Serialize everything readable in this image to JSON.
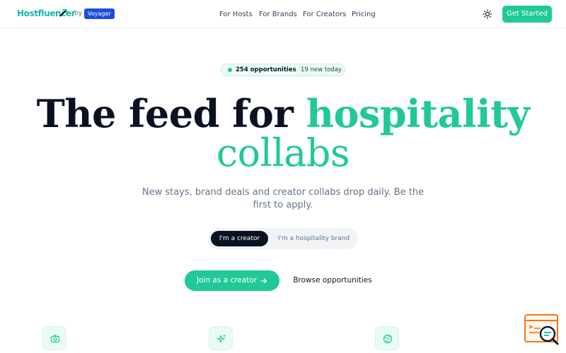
{
  "header": {
    "logo_text": "Hostfluencer",
    "by_label": "by",
    "partner_badge": "Voyager",
    "nav": [
      {
        "label": "For Hosts"
      },
      {
        "label": "For Brands"
      },
      {
        "label": "For Creators"
      },
      {
        "label": "Pricing"
      }
    ],
    "theme_toggle_icon": "sun-icon",
    "cta_label": "Get Started"
  },
  "stats_pill": {
    "count_label": "254 opportunities",
    "separator": "·",
    "new_label": "19 new today"
  },
  "hero": {
    "title_dark": "The feed for",
    "title_accent_1": "hospitality",
    "title_accent_2": "collabs",
    "subtitle": "New stays, brand deals and creator collabs drop daily. Be the first to apply."
  },
  "audience_toggle": {
    "options": [
      {
        "label": "I'm a creator",
        "selected": true
      },
      {
        "label": "I'm a hospitality brand",
        "selected": false
      }
    ]
  },
  "actions": {
    "primary_label": "Join as a creator",
    "primary_icon": "arrow-right-icon",
    "secondary_label": "Browse opportunities"
  },
  "features": {
    "icons": [
      "camera-icon",
      "sparkles-icon",
      "globe-icon"
    ]
  },
  "colors": {
    "accent": "#20c997",
    "dark": "#0b1120",
    "muted": "#64748b",
    "badge_blue": "#1d4ed8"
  }
}
